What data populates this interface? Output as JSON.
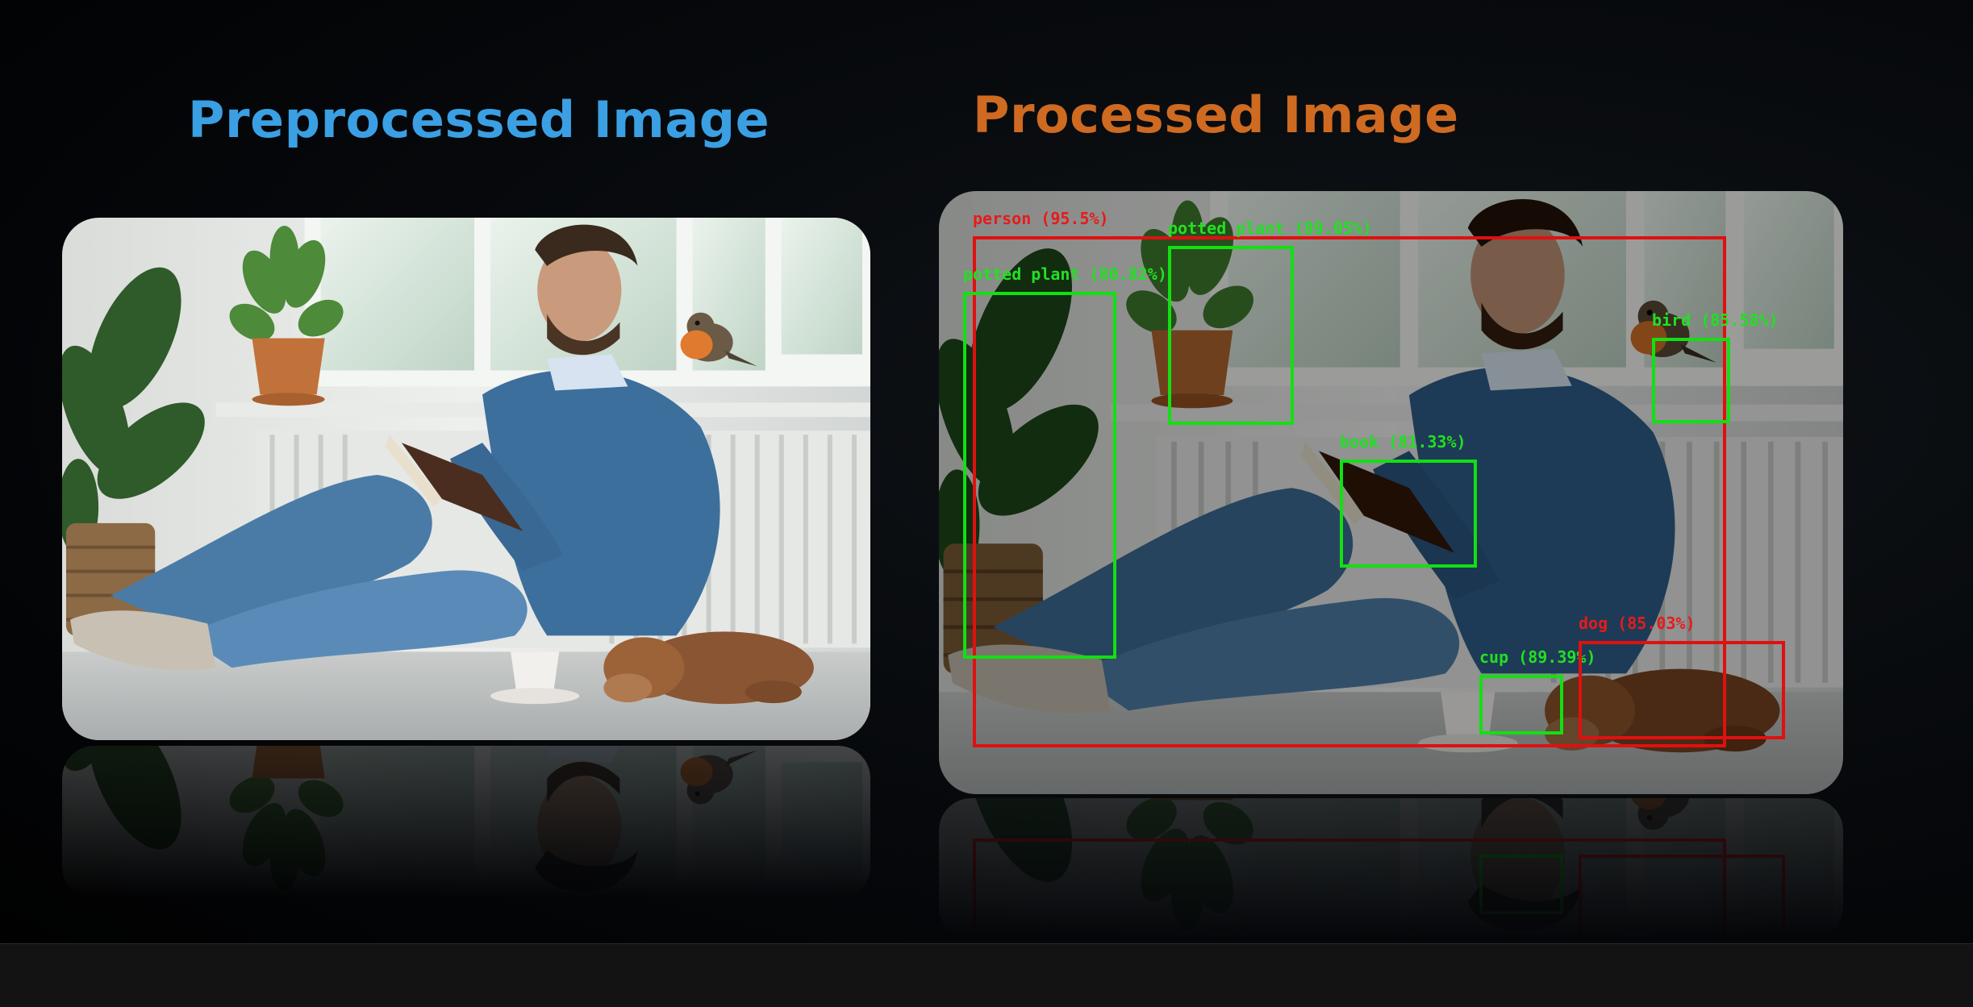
{
  "titles": {
    "preprocessed": "Preprocessed Image",
    "processed": "Processed Image"
  },
  "detections": [
    {
      "id": "person",
      "label": "person (95.5%)",
      "color": "red"
    },
    {
      "id": "potted-plant-1",
      "label": "potted plant (80.82%)",
      "color": "green"
    },
    {
      "id": "potted-plant-2",
      "label": "potted plant (89.05%)",
      "color": "green"
    },
    {
      "id": "bird",
      "label": "bird (85.58%)",
      "color": "green"
    },
    {
      "id": "book",
      "label": "book (81.33%)",
      "color": "green"
    },
    {
      "id": "cup",
      "label": "cup (89.39%)",
      "color": "green"
    },
    {
      "id": "dog",
      "label": "dog (85.03%)",
      "color": "red"
    }
  ],
  "colors": {
    "preprocessed_title": "#3b9fe3",
    "processed_title": "#cf6a21",
    "box_green": "#12e012",
    "box_red": "#e01010"
  }
}
